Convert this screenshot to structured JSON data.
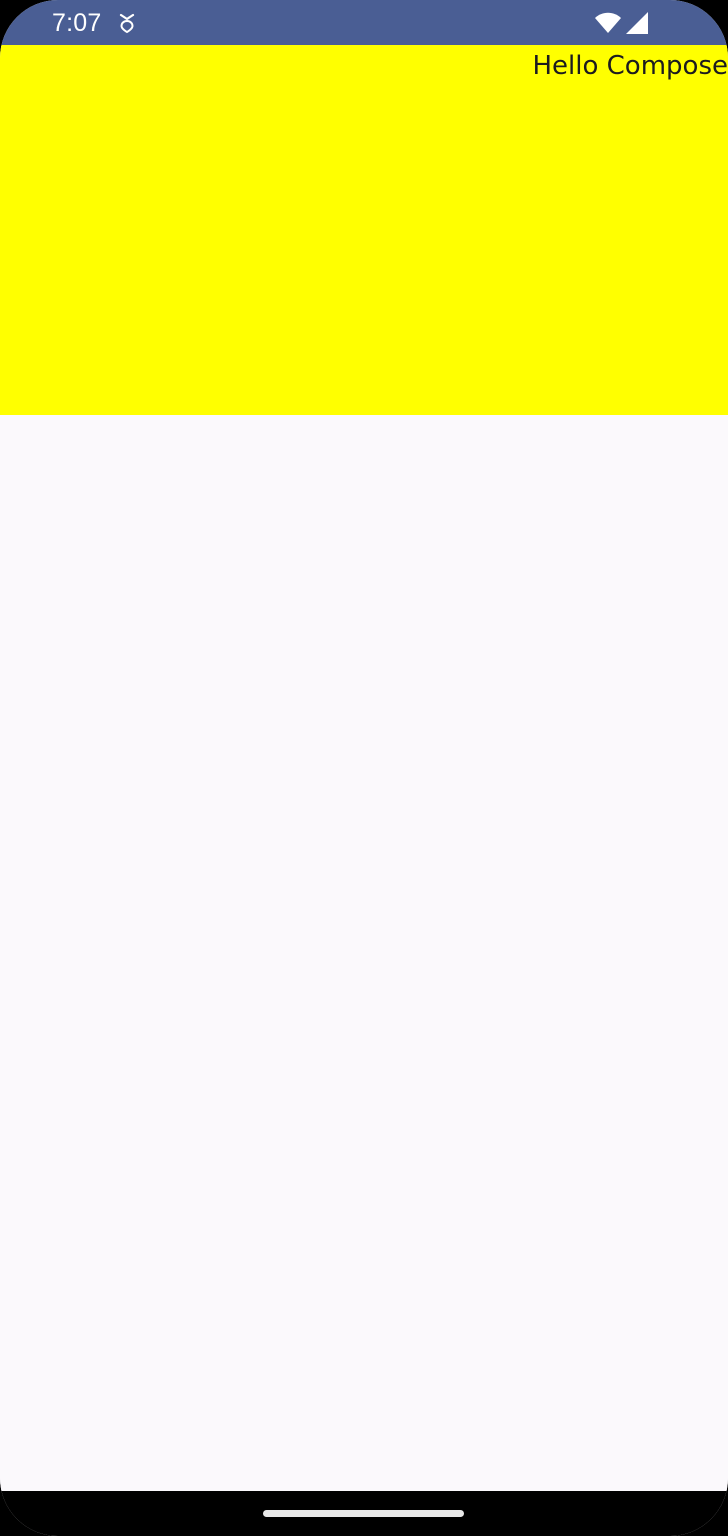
{
  "status_bar": {
    "time": "7:07",
    "notification_icon": "notification-icon",
    "wifi_icon": "wifi-icon",
    "signal_icon": "cell-signal-icon",
    "background_color": "#4a5e94"
  },
  "main": {
    "greeting": "Hello Compose",
    "box_color": "#ffff00",
    "background_color": "#fbf9fc"
  },
  "navigation": {
    "handle_icon": "home-gesture-handle"
  }
}
